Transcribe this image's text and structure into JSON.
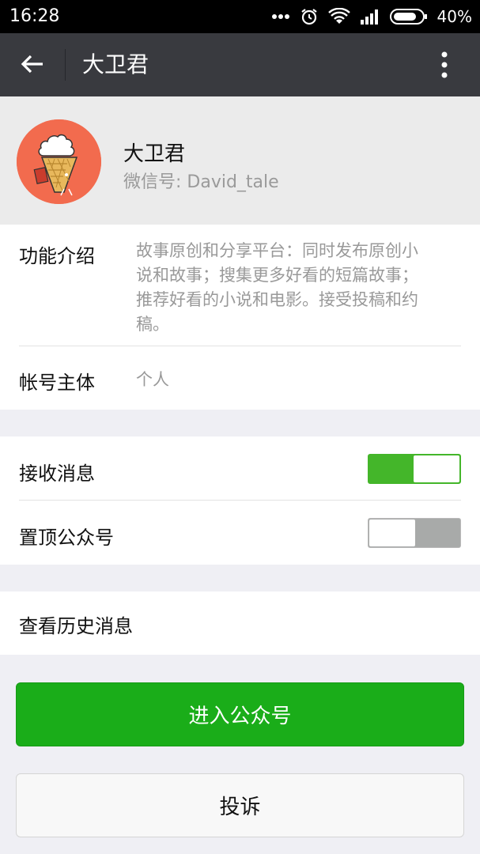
{
  "status_bar": {
    "time": "16:28",
    "battery_percent": "40%",
    "icons": [
      "more-dots-icon",
      "alarm-icon",
      "wifi-icon",
      "signal-icon",
      "battery-icon"
    ]
  },
  "app_bar": {
    "title": "大卫君",
    "back_icon": "arrow-left-icon",
    "more_icon": "more-vertical-icon"
  },
  "profile": {
    "name": "大卫君",
    "wechat_id_label": "微信号: ",
    "wechat_id": "David_tale",
    "avatar_color": "#f26b4e"
  },
  "info": {
    "intro_label": "功能介绍",
    "intro_text_lines": [
      "故事原创和分享平台：同时发布原创小",
      "说和故事；搜集更多好看的短篇故事；",
      "推荐好看的小说和电影。接受投稿和约",
      "稿。"
    ],
    "account_label": "帐号主体",
    "account_value": "个人"
  },
  "settings": {
    "receive_label": "接收消息",
    "receive_on": true,
    "pin_label": "置顶公众号",
    "pin_on": false
  },
  "history": {
    "label": "查看历史消息"
  },
  "actions": {
    "enter_label": "进入公众号",
    "complain_label": "投诉"
  },
  "colors": {
    "app_bar": "#393a3f",
    "primary_green": "#1aad19",
    "toggle_on": "#44b62a",
    "page_bg": "#efeff4"
  }
}
